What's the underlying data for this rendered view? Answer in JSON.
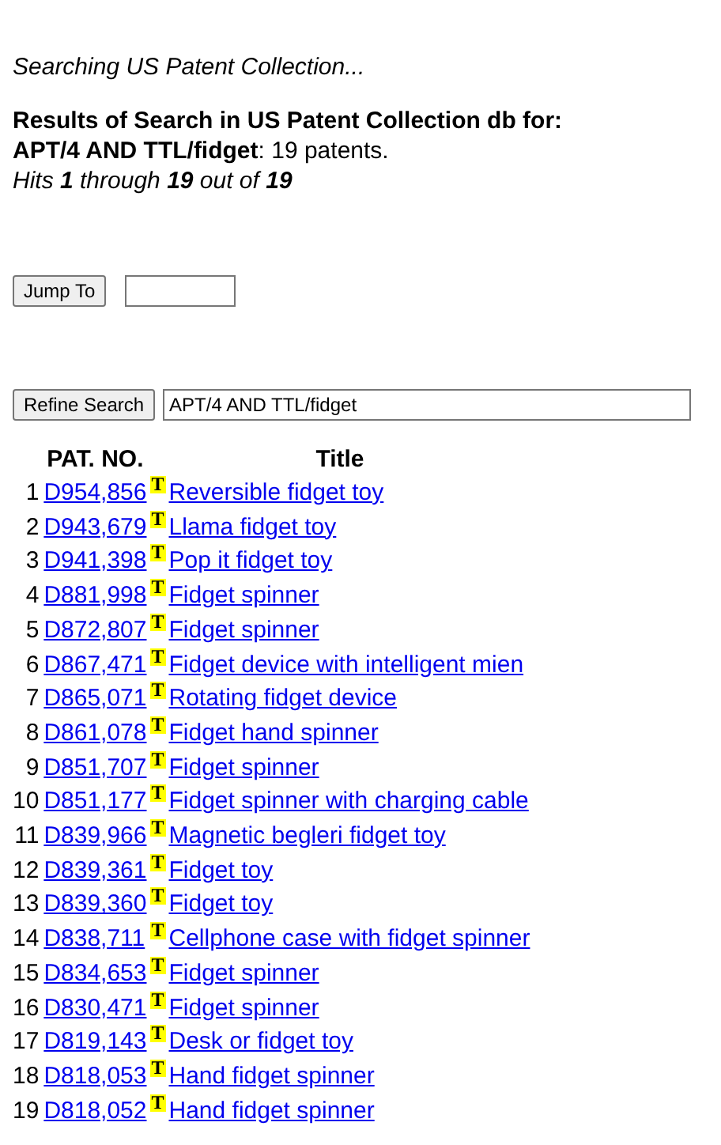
{
  "status": "Searching US Patent Collection...",
  "results_heading": "Results of Search in US Patent Collection db for:",
  "query_line": "**APT/4 AND TTL/fidget**: 19 patents.",
  "hits_line": "Hits **1** through **19** out of **19**",
  "jump": {
    "button": "Jump To"
  },
  "refine": {
    "button": "Refine Search",
    "value": "APT/4 AND TTL/fidget"
  },
  "table": {
    "columns": [
      "PAT. NO.",
      "Title"
    ],
    "rows": [
      {
        "index": "1",
        "patent": "D954,856",
        "marker": "T",
        "title": "Reversible fidget toy"
      },
      {
        "index": "2",
        "patent": "D943,679",
        "marker": "T",
        "title": "Llama fidget toy"
      },
      {
        "index": "3",
        "patent": "D941,398",
        "marker": "T",
        "title": "Pop it fidget toy"
      },
      {
        "index": "4",
        "patent": "D881,998",
        "marker": "T",
        "title": "Fidget spinner"
      },
      {
        "index": "5",
        "patent": "D872,807",
        "marker": "T",
        "title": "Fidget spinner"
      },
      {
        "index": "6",
        "patent": "D867,471",
        "marker": "T",
        "title": "Fidget device with intelligent mien"
      },
      {
        "index": "7",
        "patent": "D865,071",
        "marker": "T",
        "title": "Rotating fidget device"
      },
      {
        "index": "8",
        "patent": "D861,078",
        "marker": "T",
        "title": "Fidget hand spinner"
      },
      {
        "index": "9",
        "patent": "D851,707",
        "marker": "T",
        "title": "Fidget spinner"
      },
      {
        "index": "10",
        "patent": "D851,177",
        "marker": "T",
        "title": "Fidget spinner with charging cable"
      },
      {
        "index": "11",
        "patent": "D839,966",
        "marker": "T",
        "title": "Magnetic begleri fidget toy"
      },
      {
        "index": "12",
        "patent": "D839,361",
        "marker": "T",
        "title": "Fidget toy"
      },
      {
        "index": "13",
        "patent": "D839,360",
        "marker": "T",
        "title": "Fidget toy"
      },
      {
        "index": "14",
        "patent": "D838,711",
        "marker": "T",
        "title": "Cellphone case with fidget spinner"
      },
      {
        "index": "15",
        "patent": "D834,653",
        "marker": "T",
        "title": "Fidget spinner"
      },
      {
        "index": "16",
        "patent": "D830,471",
        "marker": "T",
        "title": "Fidget spinner"
      },
      {
        "index": "17",
        "patent": "D819,143",
        "marker": "T",
        "title": "Desk or fidget toy"
      },
      {
        "index": "18",
        "patent": "D818,053",
        "marker": "T",
        "title": "Hand fidget spinner"
      },
      {
        "index": "19",
        "patent": "D818,052",
        "marker": "T",
        "title": "Hand fidget spinner"
      }
    ]
  }
}
